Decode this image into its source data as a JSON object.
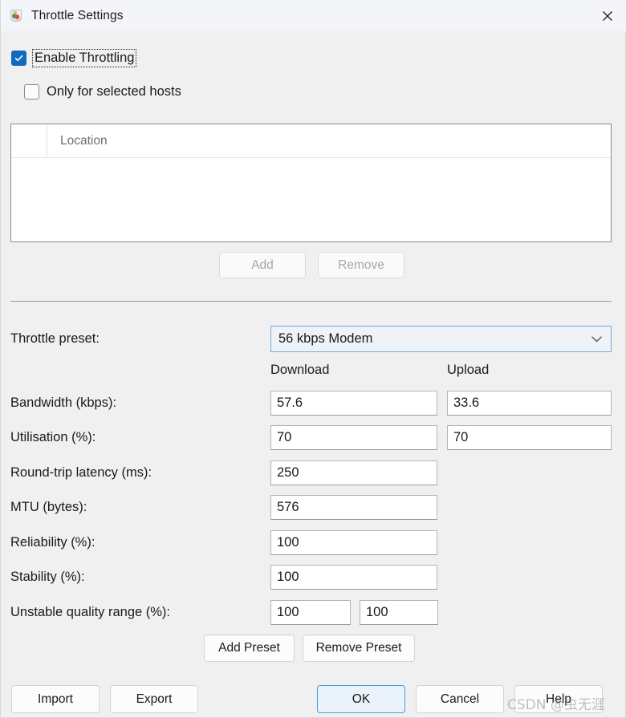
{
  "window": {
    "title": "Throttle Settings",
    "icon": "charles-proxy-icon",
    "close_label": "✕"
  },
  "options": {
    "enable_throttling": {
      "label": "Enable Throttling",
      "checked": true,
      "focused": true
    },
    "only_selected_hosts": {
      "label": "Only for selected hosts",
      "checked": false
    }
  },
  "locations_table": {
    "columns": [
      "",
      "Location"
    ],
    "header_location": "Location",
    "rows": []
  },
  "table_buttons": {
    "add": "Add",
    "remove": "Remove"
  },
  "preset": {
    "label": "Throttle preset:",
    "selected": "56 kbps Modem",
    "options": [
      "56 kbps Modem"
    ]
  },
  "columns": {
    "download": "Download",
    "upload": "Upload"
  },
  "fields": [
    {
      "label": "Bandwidth (kbps):",
      "download": "57.6",
      "upload": "33.6"
    },
    {
      "label": "Utilisation (%):",
      "download": "70",
      "upload": "70"
    },
    {
      "label": "Round-trip latency (ms):",
      "download": "250",
      "upload": null
    },
    {
      "label": "MTU (bytes):",
      "download": "576",
      "upload": null
    },
    {
      "label": "Reliability (%):",
      "download": "100",
      "upload": null
    },
    {
      "label": "Stability (%):",
      "download": "100",
      "upload": null
    }
  ],
  "unstable_range": {
    "label": "Unstable quality range (%):",
    "min": "100",
    "max": "100"
  },
  "preset_buttons": {
    "add_preset": "Add Preset",
    "remove_preset": "Remove Preset"
  },
  "footer": {
    "import": "Import",
    "export": "Export",
    "ok": "OK",
    "cancel": "Cancel",
    "help": "Help"
  },
  "watermark": "CSDN @虫无涯",
  "colors": {
    "accent_blue": "#0f6cbd",
    "ok_border": "#4b9bda",
    "ok_fill": "#eaf2fb",
    "combo_border": "#7da7cf",
    "combo_fill": "#eef3f8",
    "dialog_bg": "#f0f0f0",
    "titlebar_bg": "#f3f5f9"
  }
}
